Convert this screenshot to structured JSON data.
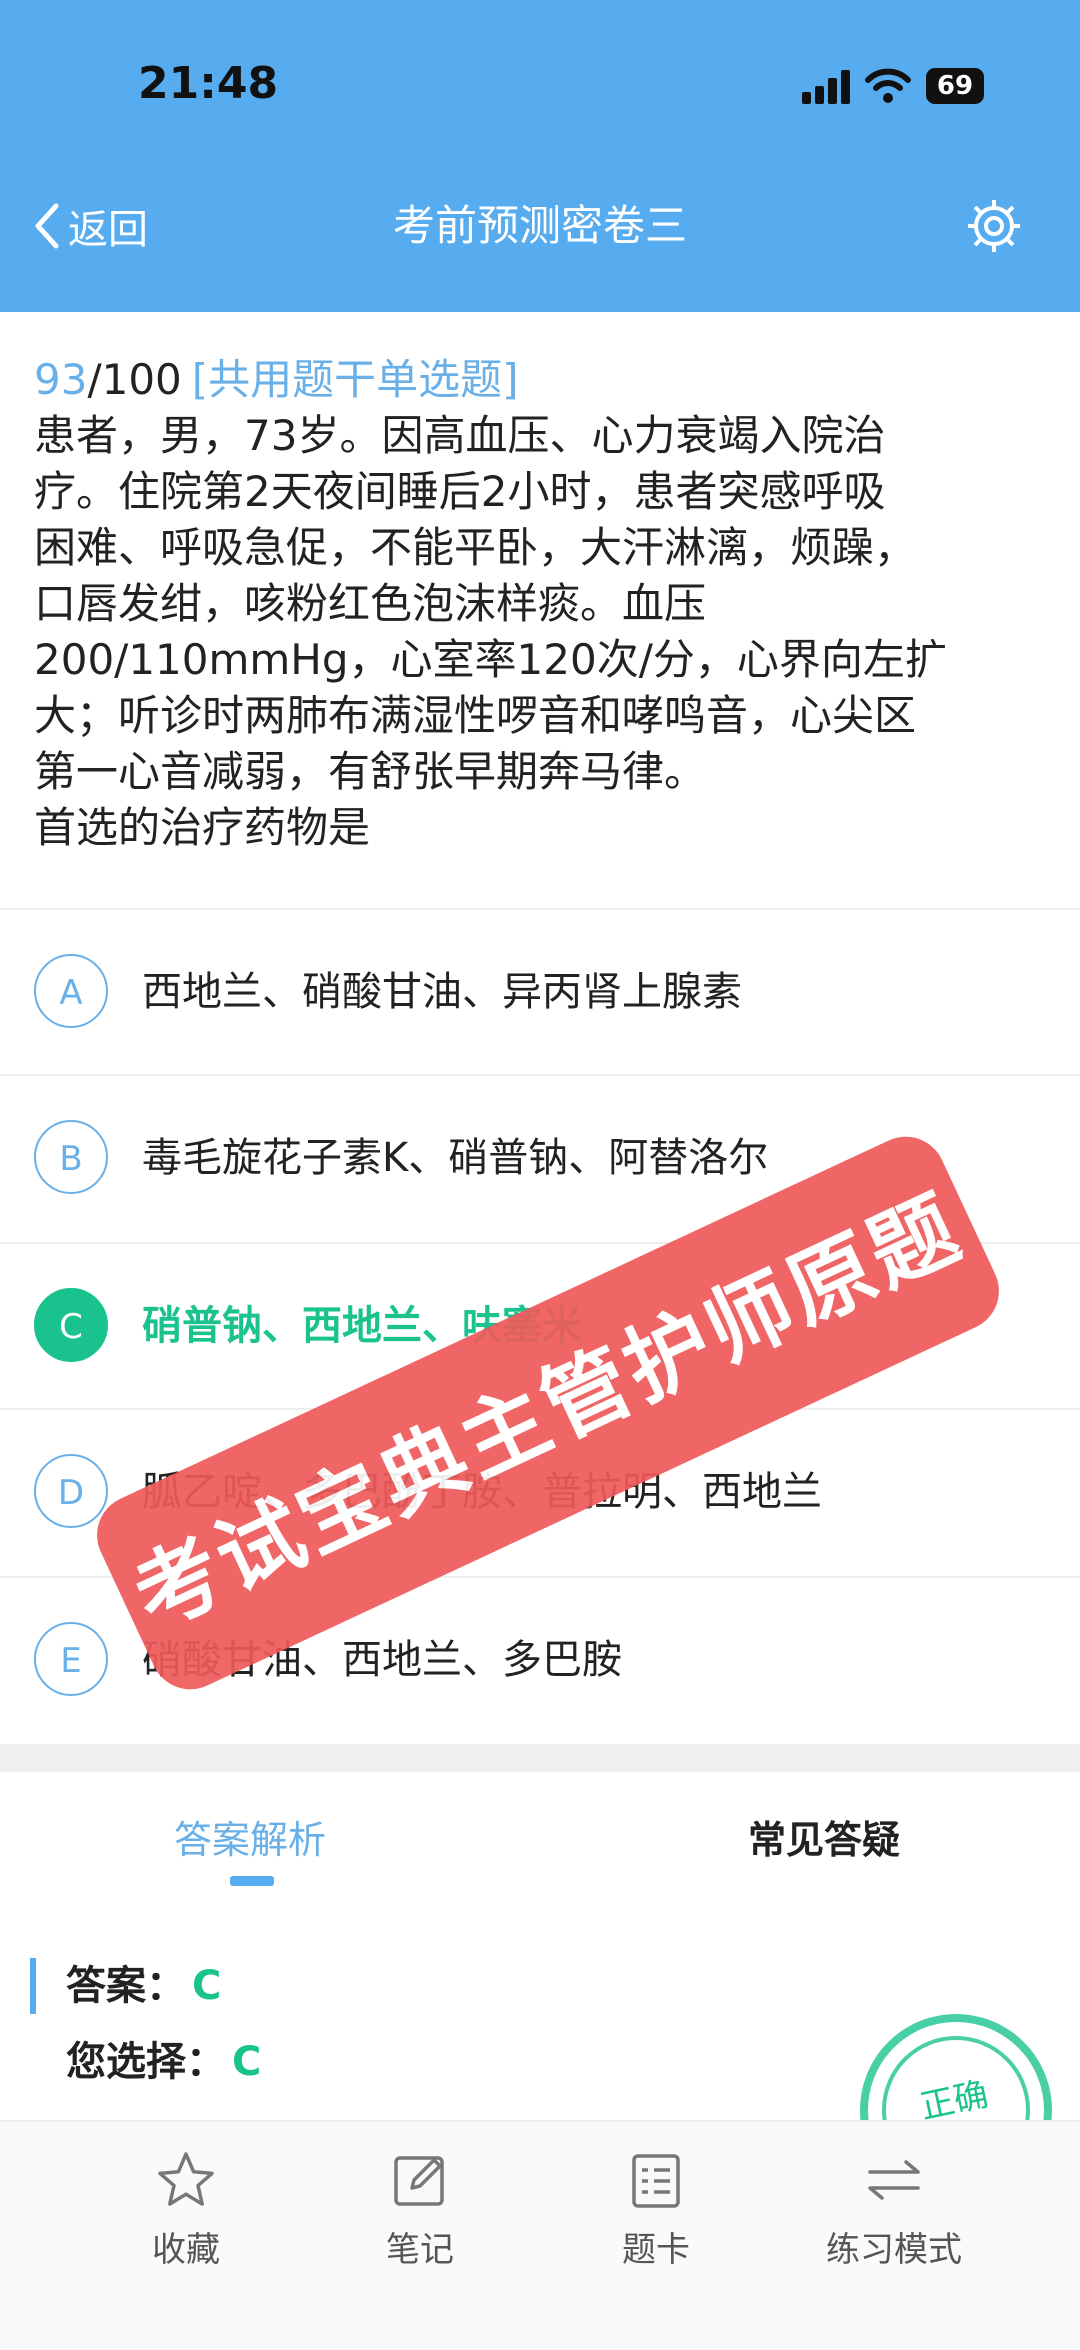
{
  "status_bar": {
    "time": "21:48",
    "battery": "69"
  },
  "nav": {
    "back_label": "返回",
    "title": "考前预测密卷三"
  },
  "question": {
    "number": "93",
    "total": "/100",
    "type": "[共用题干单选题]",
    "stem_lines": [
      "患者，男，73岁。因高血压、心力衰竭入院治",
      "疗。住院第2天夜间睡后2小时，患者突感呼吸",
      "困难、呼吸急促，不能平卧，大汗淋漓，烦躁，",
      "口唇发绀，咳粉红色泡沫样痰。血压",
      "200/110mmHg，心室率120次/分，心界向左扩",
      "大；听诊时两肺布满湿性啰音和哮鸣音，心尖区",
      "第一心音减弱，有舒张早期奔马律。",
      "首选的治疗药物是"
    ]
  },
  "options": [
    {
      "letter": "A",
      "text": "西地兰、硝酸甘油、异丙肾上腺素"
    },
    {
      "letter": "B",
      "text": "毒毛旋花子素K、硝普钠、阿替洛尔"
    },
    {
      "letter": "C",
      "text": "硝普钠、西地兰、呋塞米"
    },
    {
      "letter": "D",
      "text": "胍乙啶、多巴酚丁胺、普拉明、西地兰"
    },
    {
      "letter": "E",
      "text": "硝酸甘油、西地兰、多巴胺"
    }
  ],
  "watermark": "考试宝典主管护师原题",
  "tabs": {
    "analysis": "答案解析",
    "faq": "常见答疑"
  },
  "answer": {
    "label": "答案：",
    "value": "C",
    "your_label": "您选择：",
    "your_value": "C"
  },
  "stamp_text": "正确",
  "toolbar": {
    "favorite": "收藏",
    "notes": "笔记",
    "card": "题卡",
    "mode": "练习模式"
  },
  "colors": {
    "header": "#57acef",
    "accent": "#6ab0e8",
    "correct": "#1ac38e",
    "watermark": "#ef5a5a"
  }
}
